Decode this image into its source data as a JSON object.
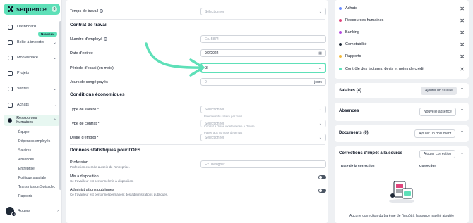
{
  "sidebar": {
    "logo": "sequence",
    "badge": "6",
    "new_badge": "Nouveau",
    "items": [
      {
        "label": "Dashboard",
        "chev": ""
      },
      {
        "label": "Boîte à importer",
        "chev": "⌄"
      },
      {
        "label": "Mon espace",
        "chev": "⌄"
      },
      {
        "label": "Projets",
        "chev": ""
      },
      {
        "label": "Ventes",
        "chev": "⌄"
      },
      {
        "label": "Achats",
        "chev": "⌄"
      },
      {
        "label": "Ressources humaines",
        "chev": "⌃"
      }
    ],
    "subitems": [
      "Équipe",
      "Dépenses employés",
      "Salaires",
      "Absences",
      "Entreprise",
      "Politique salariale",
      "Transmission Swissdec",
      "Rapports"
    ],
    "user": {
      "name": "Rogers",
      "count": "48"
    }
  },
  "form": {
    "top_label": "Temps de travail",
    "top_placeholder": "Sélectionner",
    "section_contrat": "Contrat de travail",
    "numero_label": "Numéro d'employé",
    "numero_placeholder": "Ex. 5874",
    "entree_label": "Date d'entrée",
    "entree_value": "9/2/2022",
    "essai_label": "Période d'essai (en mois)",
    "essai_value": "3",
    "conges_label": "Jours de congé payés",
    "conges_value": "0",
    "conges_unit": "jours",
    "section_eco": "Conditions économiques",
    "salaire_label": "Type de salaire *",
    "salaire_placeholder": "Sélectionner",
    "salaire_hint": "Paiement du salaire par mois",
    "contrat_label": "Type de contrat *",
    "contrat_placeholder": "Sélectionner",
    "contrat_hint": "Contrat à durée indéterminée à l'heure",
    "emploi_label": "Degré d'emploi *",
    "emploi_placeholder": "Sélectionner",
    "emploi_hint": "Payée aux contrats de temps",
    "section_ofs": "Données statistiques pour l'OFS",
    "profession_label": "Profession",
    "profession_sub": "Profession exercée au sein de l'entreprise.",
    "profession_placeholder": "Ex. Designer",
    "dispo_label": "Mis à disposition",
    "dispo_sub": "Ce travailleur est personnel mis à disposition.",
    "admin_label": "Administrations publiques",
    "admin_sub": "Ce travailleur est personnel permanent des administrations publiques."
  },
  "right": {
    "chips": [
      {
        "label": "Achats",
        "color": "#6b8cff"
      },
      {
        "label": "Ressources humaines",
        "color": "#e0447c"
      },
      {
        "label": "Banking",
        "color": "#b44ae0"
      },
      {
        "label": "Comptabilité",
        "color": "#1f2937"
      },
      {
        "label": "Rapports",
        "color": "#f2b93b"
      },
      {
        "label": "Contrôle des factures, devis et notes de crédit",
        "color": "#5ee0b8"
      }
    ],
    "salaires_title": "Salaires (4)",
    "salaires_btn": "Ajouter un salaire",
    "absences_title": "Absences",
    "absences_btn": "Nouvelle absence",
    "documents_title": "Documents (0)",
    "documents_btn": "Ajouter un document",
    "corrections_title": "Corrections d'impôt à la source",
    "corrections_btn": "Ajouter correction",
    "col_date": "Date de la correction",
    "col_correction": "Correction",
    "empty_text": "Aucune correction du barème de l'impôt à la source n'a été ajoutée"
  }
}
